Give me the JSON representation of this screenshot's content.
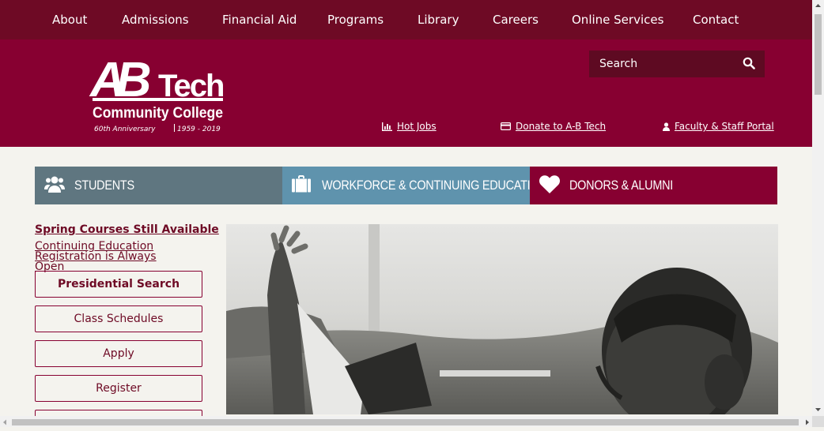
{
  "topnav": {
    "items": [
      "About",
      "Admissions",
      "Financial Aid",
      "Programs",
      "Library",
      "Careers",
      "Online Services",
      "Contact"
    ]
  },
  "header": {
    "logo": {
      "mark": "AB",
      "word": "Tech",
      "name": "Community College",
      "anniversary": "60th Anniversary",
      "years": "1959 - 2019"
    },
    "search_placeholder": "Search",
    "links": {
      "hot_jobs": "Hot Jobs",
      "donate": "Donate to A-B Tech",
      "portal": "Faculty & Staff Portal"
    }
  },
  "tiles": {
    "students": "STUDENTS",
    "workforce": "WORKFORCE & CONTINUING EDUCATION",
    "donors": "DONORS & ALUMNI"
  },
  "sidebar": {
    "spring": "Spring Courses Still Available",
    "continuing": "Continuing Education Registration is Always Open",
    "buttons": [
      "Presidential Search",
      "Class Schedules",
      "Apply",
      "Register"
    ]
  },
  "colors": {
    "brand": "#870031",
    "brand_dark": "#6e0a25",
    "students_tile": "#5f7680",
    "workforce_tile": "#5f93ad",
    "donors_tile": "#870031"
  }
}
